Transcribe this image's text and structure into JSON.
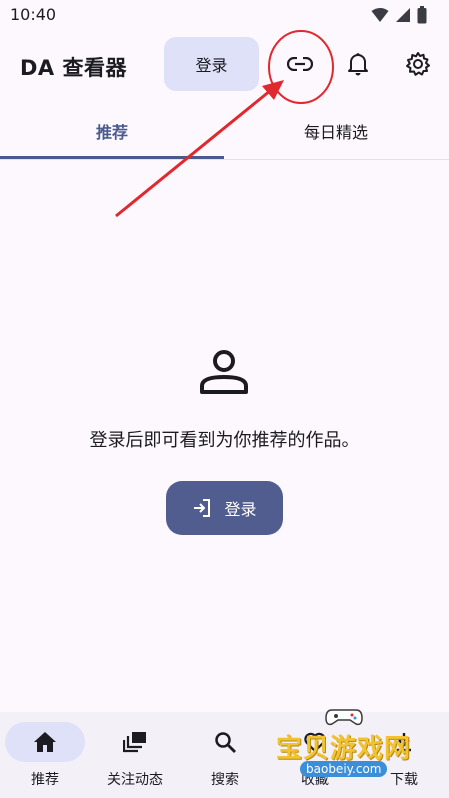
{
  "status_bar": {
    "time": "10:40"
  },
  "app_bar": {
    "title": "DA 查看器",
    "login_chip": "登录"
  },
  "tabs": [
    {
      "label": "推荐",
      "active": true
    },
    {
      "label": "每日精选",
      "active": false
    }
  ],
  "empty_state": {
    "message": "登录后即可看到为你推荐的作品。",
    "login_button": "登录"
  },
  "bottom_nav": [
    {
      "label": "推荐",
      "icon": "home-icon",
      "active": true
    },
    {
      "label": "关注动态",
      "icon": "feed-stack-icon",
      "active": false
    },
    {
      "label": "搜索",
      "icon": "search-icon",
      "active": false
    },
    {
      "label": "收藏",
      "icon": "favorite-icon",
      "active": false
    },
    {
      "label": "下载",
      "icon": "download-icon",
      "active": false
    }
  ],
  "colors": {
    "accent": "#4b5a8c",
    "button": "#515d8e",
    "chip": "#dfe1f9",
    "annotation": "#e0282e"
  },
  "watermark": {
    "text": "宝贝游戏网",
    "url": "baobeiy.com"
  }
}
